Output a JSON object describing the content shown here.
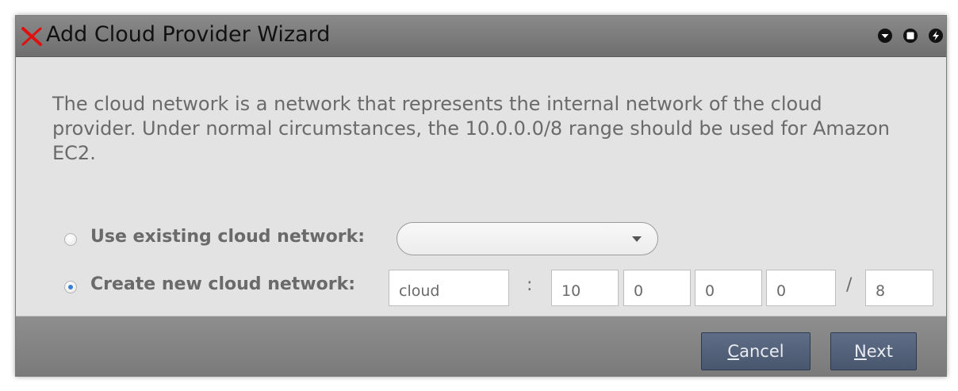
{
  "window": {
    "title": "Add Cloud Provider Wizard",
    "controls": [
      "minimize-icon",
      "maximize-icon",
      "close-icon"
    ]
  },
  "description": "The cloud network is a network that represents the internal network of the cloud provider. Under normal circumstances, the 10.0.0.0/8 range should be used for Amazon EC2.",
  "options": {
    "existing": {
      "label": "Use existing cloud network:",
      "selected": false,
      "combo_value": ""
    },
    "create": {
      "label": "Create new cloud network:",
      "selected": true,
      "name_value": "cloud",
      "colon": ":",
      "ip": [
        "10",
        "0",
        "0",
        "0"
      ],
      "slash": "/",
      "prefix": "8"
    }
  },
  "buttons": {
    "cancel": {
      "mnemonic": "C",
      "rest": "ancel"
    },
    "next": {
      "mnemonic": "N",
      "rest": "ext"
    }
  },
  "colors": {
    "titlebar": "#7c7c7c",
    "body": "#e3e3e3",
    "button": "#536178",
    "logo": "#e01010",
    "radio_accent": "#3a7fd6"
  }
}
